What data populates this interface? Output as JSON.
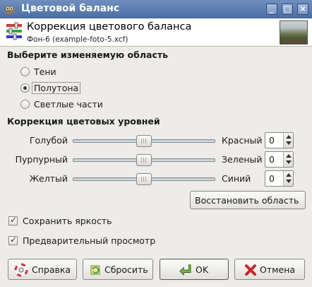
{
  "window": {
    "title": "Цветовой баланс",
    "controls": [
      "minimize",
      "maximize",
      "close"
    ]
  },
  "header": {
    "title": "Коррекция цветового баланса",
    "subtitle": "Фон-6 (example-foto-5.xcf)"
  },
  "range_section": {
    "title": "Выберите изменяемую область",
    "options": [
      {
        "label": "Тени",
        "selected": false
      },
      {
        "label": "Полутона",
        "selected": true
      },
      {
        "label": "Светлые части",
        "selected": false
      }
    ]
  },
  "levels_section": {
    "title": "Коррекция цветовых уровней",
    "sliders": [
      {
        "left": "Голубой",
        "right": "Красный",
        "value": "0",
        "level": 0
      },
      {
        "left": "Пурпурный",
        "right": "Зеленый",
        "value": "0",
        "level": 0
      },
      {
        "left": "Желтый",
        "right": "Синий",
        "value": "0",
        "level": 0
      }
    ],
    "slider_range": [
      -100,
      100
    ],
    "reset_range_label": "Восстановить область"
  },
  "options": {
    "preserve_luminosity": {
      "label": "Сохранить яркость",
      "checked": true
    },
    "preview": {
      "label": "Предварительный просмотр",
      "checked": true
    }
  },
  "buttons": {
    "help": {
      "label": "Справка",
      "icon": "lifebuoy-icon"
    },
    "reset": {
      "label": "Сбросить",
      "icon": "reset-icon"
    },
    "ok": {
      "label": "OK",
      "icon": "ok-arrow-icon"
    },
    "cancel": {
      "label": "Отмена",
      "icon": "cancel-x-icon"
    }
  },
  "colors": {
    "titlebar": "#5a7bb0",
    "background": "#eeece8"
  }
}
